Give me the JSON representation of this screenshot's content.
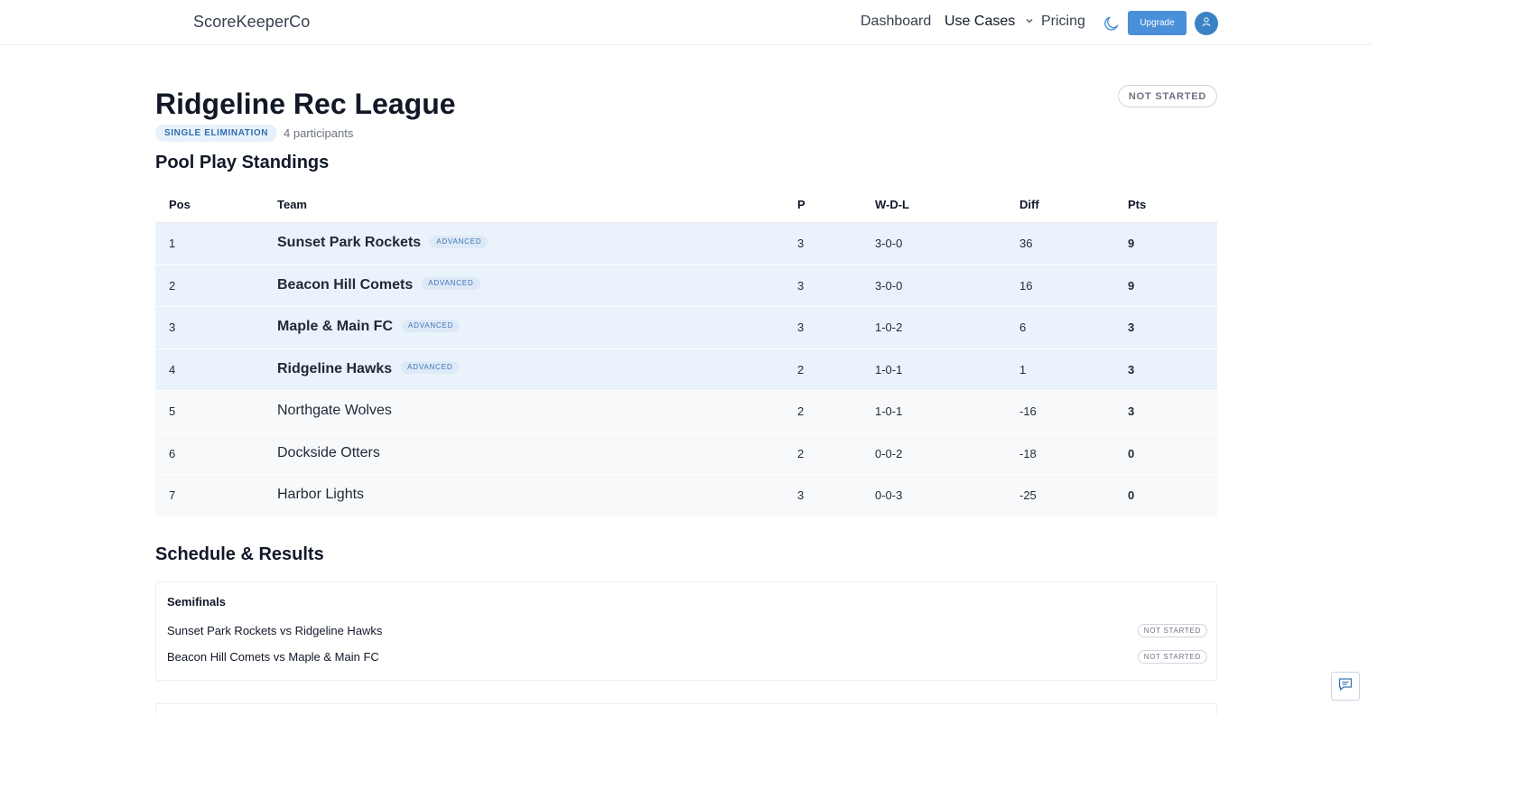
{
  "header": {
    "brand": "ScoreKeeperCo",
    "nav": {
      "dashboard": "Dashboard",
      "use_cases": "Use Cases",
      "pricing": "Pricing"
    },
    "upgrade_label": "Upgrade",
    "icons": [
      "moon-icon",
      "chevron-down-icon",
      "user-icon"
    ]
  },
  "tournament": {
    "title": "Ridgeline Rec League",
    "status": "NOT STARTED",
    "format": "SINGLE ELIMINATION",
    "participants": "4 participants"
  },
  "standings": {
    "title": "Pool Play Standings",
    "columns": {
      "pos": "Pos",
      "team": "Team",
      "p": "P",
      "wdl": "W-D-L",
      "diff": "Diff",
      "pts": "Pts"
    },
    "advanced_label": "ADVANCED",
    "rows": [
      {
        "pos": "1",
        "team": "Sunset Park Rockets",
        "advanced": true,
        "p": "3",
        "wdl": "3-0-0",
        "diff": "36",
        "pts": "9"
      },
      {
        "pos": "2",
        "team": "Beacon Hill Comets",
        "advanced": true,
        "p": "3",
        "wdl": "3-0-0",
        "diff": "16",
        "pts": "9"
      },
      {
        "pos": "3",
        "team": "Maple & Main FC",
        "advanced": true,
        "p": "3",
        "wdl": "1-0-2",
        "diff": "6",
        "pts": "3"
      },
      {
        "pos": "4",
        "team": "Ridgeline Hawks",
        "advanced": true,
        "p": "2",
        "wdl": "1-0-1",
        "diff": "1",
        "pts": "3"
      },
      {
        "pos": "5",
        "team": "Northgate Wolves",
        "advanced": false,
        "p": "2",
        "wdl": "1-0-1",
        "diff": "-16",
        "pts": "3"
      },
      {
        "pos": "6",
        "team": "Dockside Otters",
        "advanced": false,
        "p": "2",
        "wdl": "0-0-2",
        "diff": "-18",
        "pts": "0"
      },
      {
        "pos": "7",
        "team": "Harbor Lights",
        "advanced": false,
        "p": "3",
        "wdl": "0-0-3",
        "diff": "-25",
        "pts": "0"
      }
    ]
  },
  "schedule": {
    "title": "Schedule & Results",
    "round": "Semifinals",
    "matches": [
      {
        "label": "Sunset Park Rockets vs Ridgeline Hawks",
        "status": "NOT STARTED"
      },
      {
        "label": "Beacon Hill Comets vs Maple & Main FC",
        "status": "NOT STARTED"
      }
    ]
  },
  "colors": {
    "accent": "#4a90d9",
    "advanced_row": "#eaf2fb",
    "normal_row": "#f7f9fb"
  }
}
